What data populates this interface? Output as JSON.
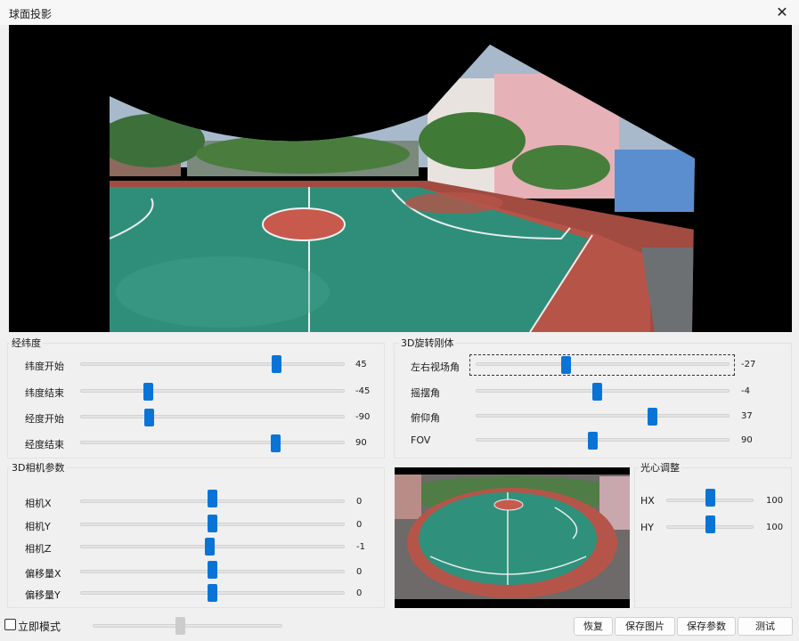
{
  "window": {
    "title": "球面投影",
    "close_icon": "close-icon"
  },
  "latlon": {
    "title": "经纬度",
    "rows": [
      {
        "label": "纬度开始",
        "value": "45"
      },
      {
        "label": "纬度结束",
        "value": "-45"
      },
      {
        "label": "经度开始",
        "value": "-90"
      },
      {
        "label": "经度结束",
        "value": "90"
      }
    ]
  },
  "rotation": {
    "title": "3D旋转刚体",
    "rows": [
      {
        "label": "左右视场角",
        "value": "-27"
      },
      {
        "label": "摇摆角",
        "value": "-4"
      },
      {
        "label": "俯仰角",
        "value": "37"
      },
      {
        "label": "FOV",
        "value": "90"
      }
    ]
  },
  "camera": {
    "title": "3D相机参数",
    "rows": [
      {
        "label": "相机X",
        "value": "0"
      },
      {
        "label": "相机Y",
        "value": "0"
      },
      {
        "label": "相机Z",
        "value": "-1"
      },
      {
        "label": "偏移量X",
        "value": "0"
      },
      {
        "label": "偏移量Y",
        "value": "0"
      }
    ]
  },
  "center": {
    "title": "光心调整",
    "rows": [
      {
        "label": "HX",
        "value": "100"
      },
      {
        "label": "HY",
        "value": "100"
      }
    ]
  },
  "bottom": {
    "immediate_mode": "立即模式",
    "buttons": [
      "恢复",
      "保存图片",
      "保存参数",
      "测试"
    ]
  }
}
